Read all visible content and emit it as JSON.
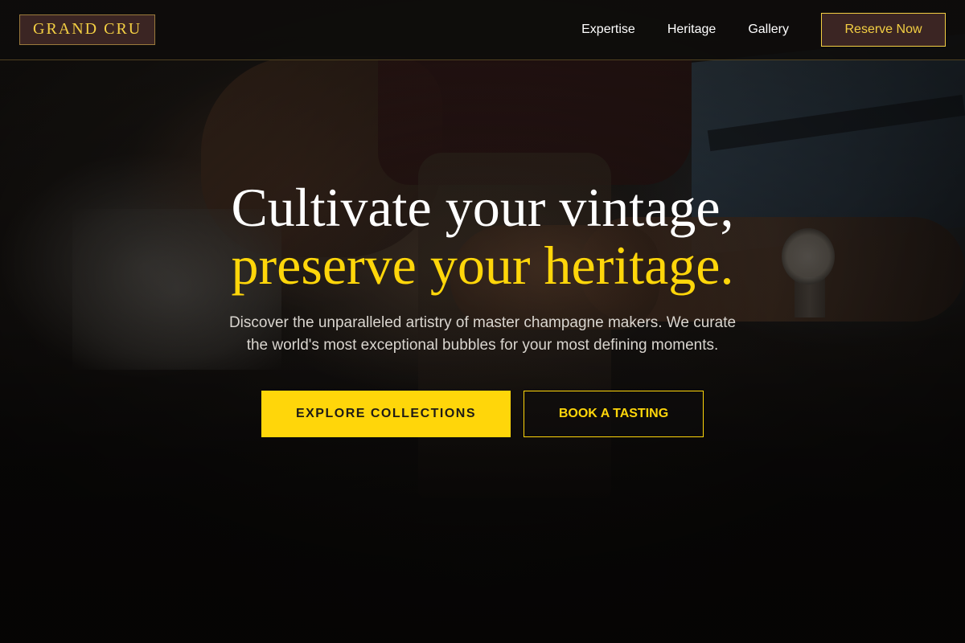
{
  "brand": {
    "name": "GRAND CRU"
  },
  "nav": {
    "links": [
      "Expertise",
      "Heritage",
      "Gallery"
    ],
    "reserve_label": "Reserve Now"
  },
  "hero": {
    "headline_line1": "Cultivate your vintage,",
    "headline_line2": "preserve your heritage.",
    "subtext": "Discover the unparalleled artistry of master champagne makers. We curate the world's most exceptional bubbles for your most defining moments.",
    "primary_cta": "EXPLORE COLLECTIONS",
    "secondary_cta": "BOOK A TASTING"
  },
  "colors": {
    "accent_gold": "#ffd60a",
    "logo_gold": "#f3cf43",
    "button_brown": "#3b2523",
    "background_dark": "#0d0c0b"
  }
}
